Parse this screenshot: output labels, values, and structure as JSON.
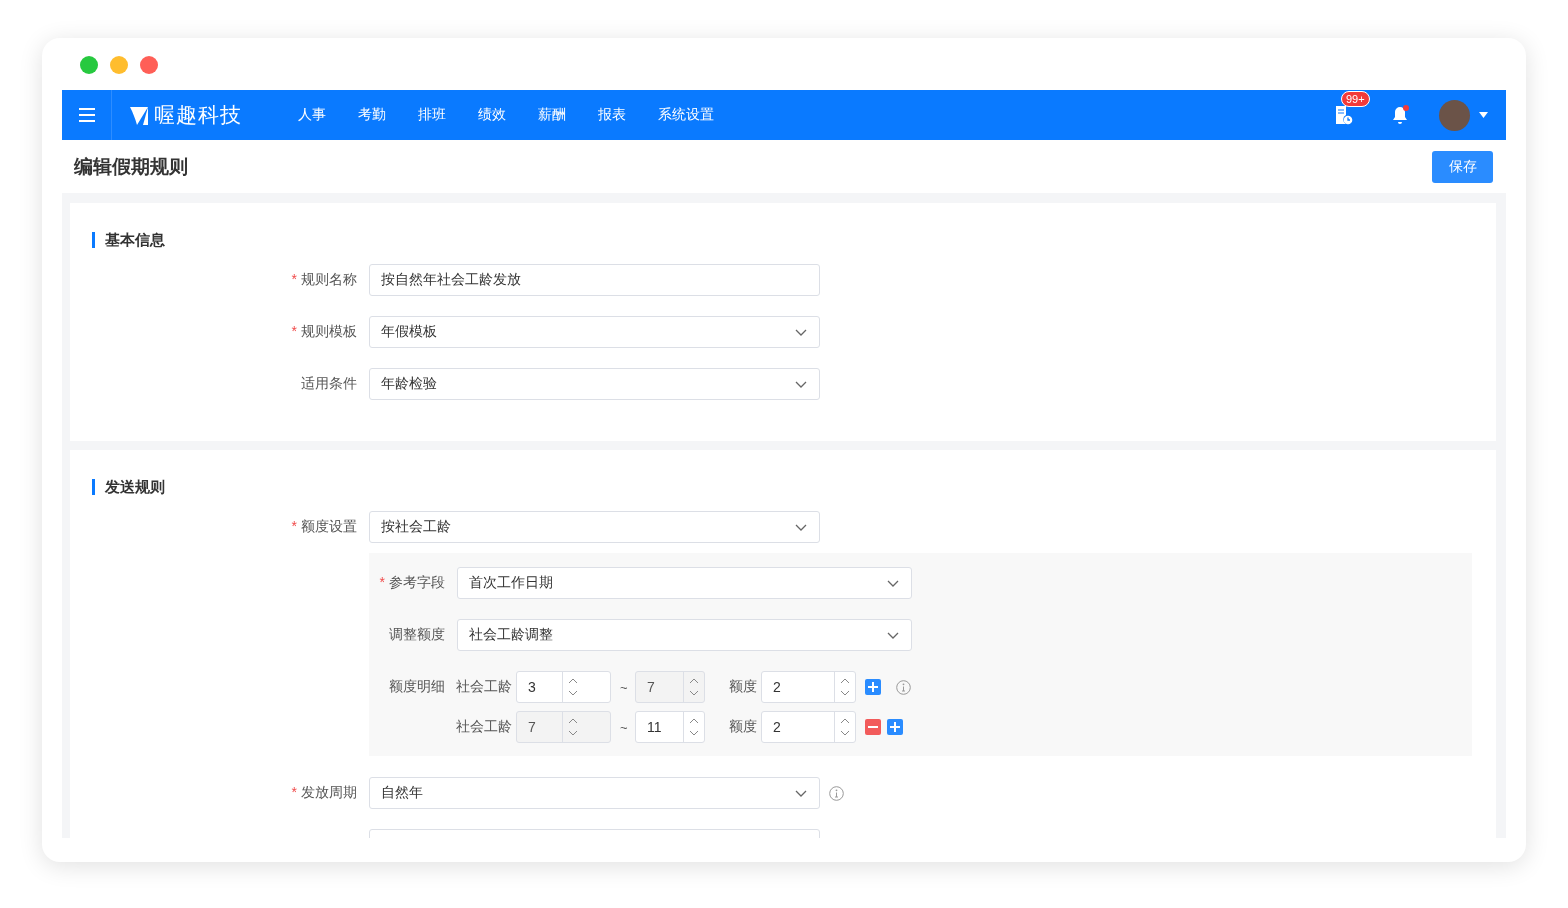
{
  "window": {
    "lights": [
      {
        "color": "#27c93f"
      },
      {
        "color": "#ffbd2e"
      },
      {
        "color": "#ff5f57"
      }
    ]
  },
  "navbar": {
    "logo_text": "喔趣科技",
    "menu": [
      "人事",
      "考勤",
      "排班",
      "绩效",
      "薪酬",
      "报表",
      "系统设置"
    ],
    "badge": "99+",
    "bell_dot": true
  },
  "page": {
    "title": "编辑假期规则",
    "save_button": "保存"
  },
  "required_mark": "*",
  "sections": [
    {
      "title": "基本信息",
      "fields": [
        {
          "kind": "text",
          "label": "规则名称",
          "required": true,
          "value": "按自然年社会工龄发放",
          "info": false
        },
        {
          "kind": "select",
          "label": "规则模板",
          "required": true,
          "value": "年假模板",
          "info": false
        },
        {
          "kind": "select",
          "label": "适用条件",
          "required": false,
          "value": "年龄检验",
          "info": false
        }
      ]
    },
    {
      "title": "发送规则",
      "fields": [
        {
          "kind": "select",
          "label": "额度设置",
          "required": true,
          "value": "按社会工龄",
          "info": false
        },
        {
          "kind": "panel",
          "fields": [
            {
              "kind": "select",
              "label": "参考字段",
              "required": true,
              "value": "首次工作日期",
              "info": false
            },
            {
              "kind": "select",
              "label": "调整额度",
              "required": false,
              "value": "社会工龄调整",
              "info": false
            }
          ],
          "detail": {
            "label": "额度明细",
            "rows": [
              {
                "label": "社会工龄",
                "from": {
                  "value": "3",
                  "disabled": false
                },
                "separator": "~",
                "to": {
                  "value": "7",
                  "disabled": true
                },
                "amount_label": "额度",
                "amount": {
                  "value": "2",
                  "disabled": false
                },
                "buttons": [
                  {
                    "kind": "add"
                  }
                ],
                "info": true
              },
              {
                "label": "社会工龄",
                "from": {
                  "value": "7",
                  "disabled": true
                },
                "separator": "~",
                "to": {
                  "value": "11",
                  "disabled": false
                },
                "amount_label": "额度",
                "amount": {
                  "value": "2",
                  "disabled": false
                },
                "buttons": [
                  {
                    "kind": "remove"
                  },
                  {
                    "kind": "add"
                  }
                ],
                "info": false
              }
            ]
          }
        },
        {
          "kind": "select",
          "label": "发放周期",
          "required": true,
          "value": "自然年",
          "info": true
        },
        {
          "kind": "cut"
        }
      ]
    }
  ]
}
